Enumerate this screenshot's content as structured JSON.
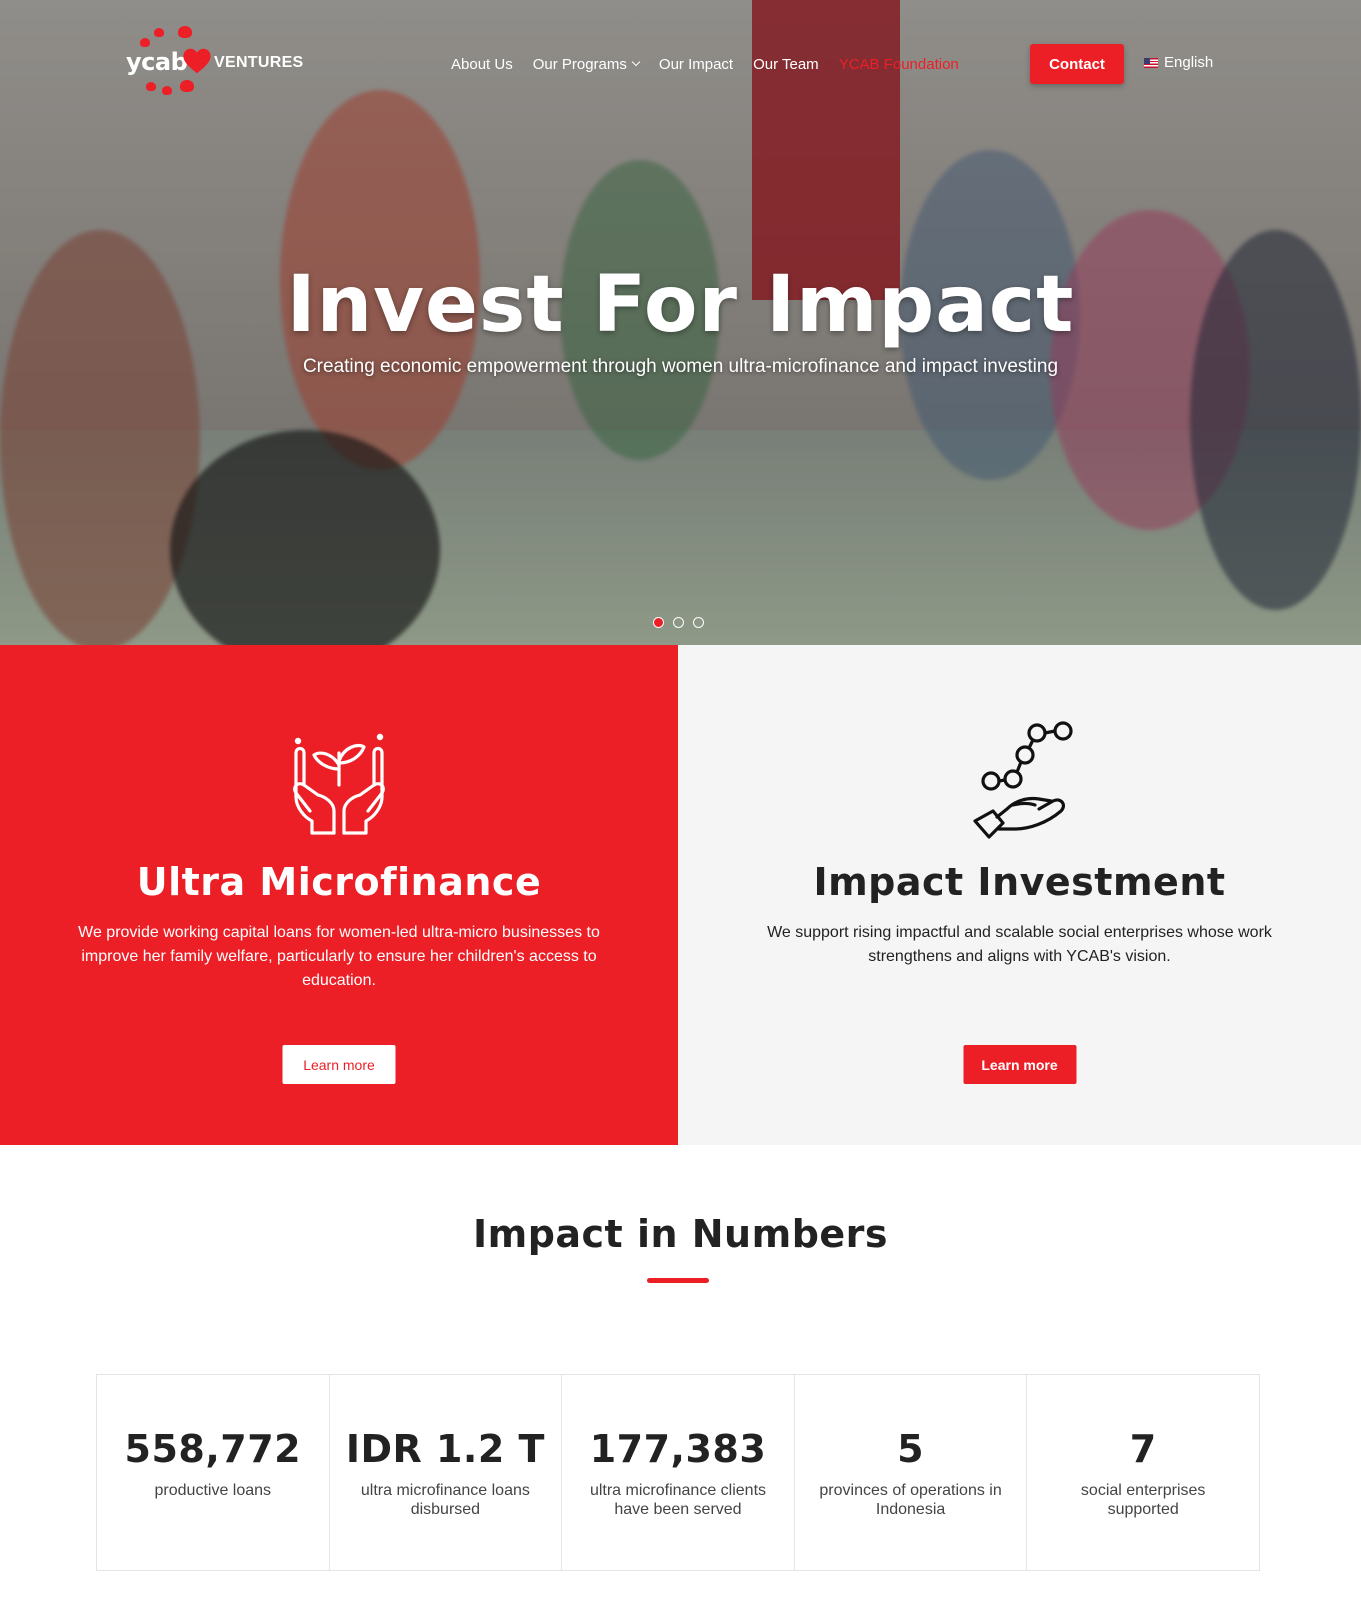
{
  "brand": {
    "logo_text": "ycab",
    "logo_suffix": "VENTURES",
    "accent": "#ec1f27"
  },
  "nav": {
    "items": [
      {
        "label": "About Us",
        "dropdown": false
      },
      {
        "label": "Our Programs",
        "dropdown": true
      },
      {
        "label": "Our Impact",
        "dropdown": false
      },
      {
        "label": "Our Team",
        "dropdown": false
      },
      {
        "label": "YCAB Foundation",
        "dropdown": false
      }
    ],
    "contact_label": "Contact",
    "language": "English",
    "language_icon": "us-flag-icon"
  },
  "hero": {
    "title": "Invest For Impact",
    "subtitle": "Creating economic empowerment through women ultra-microfinance and impact investing",
    "slides": 3,
    "active_slide": 1
  },
  "programs": [
    {
      "icon": "hands-plant-icon",
      "title": "Ultra Microfinance",
      "description": "We provide working capital loans for women-led ultra-micro businesses to improve her family welfare, particularly to ensure her children's access to education.",
      "button": "Learn more"
    },
    {
      "icon": "hand-growth-chart-icon",
      "title": "Impact Investment",
      "description": "We support rising impactful and scalable social enterprises whose work strengthens and aligns with YCAB's vision.",
      "button": "Learn more"
    }
  ],
  "numbers": {
    "title": "Impact in Numbers",
    "stats": [
      {
        "value": "558,772",
        "label": "productive loans"
      },
      {
        "value": "IDR 1.2 T",
        "label": "ultra microfinance loans disbursed"
      },
      {
        "value": "177,383",
        "label": "ultra microfinance clients have been served"
      },
      {
        "value": "5",
        "label": "provinces of operations in Indonesia"
      },
      {
        "value": "7",
        "label": "social enterprises supported"
      }
    ]
  }
}
